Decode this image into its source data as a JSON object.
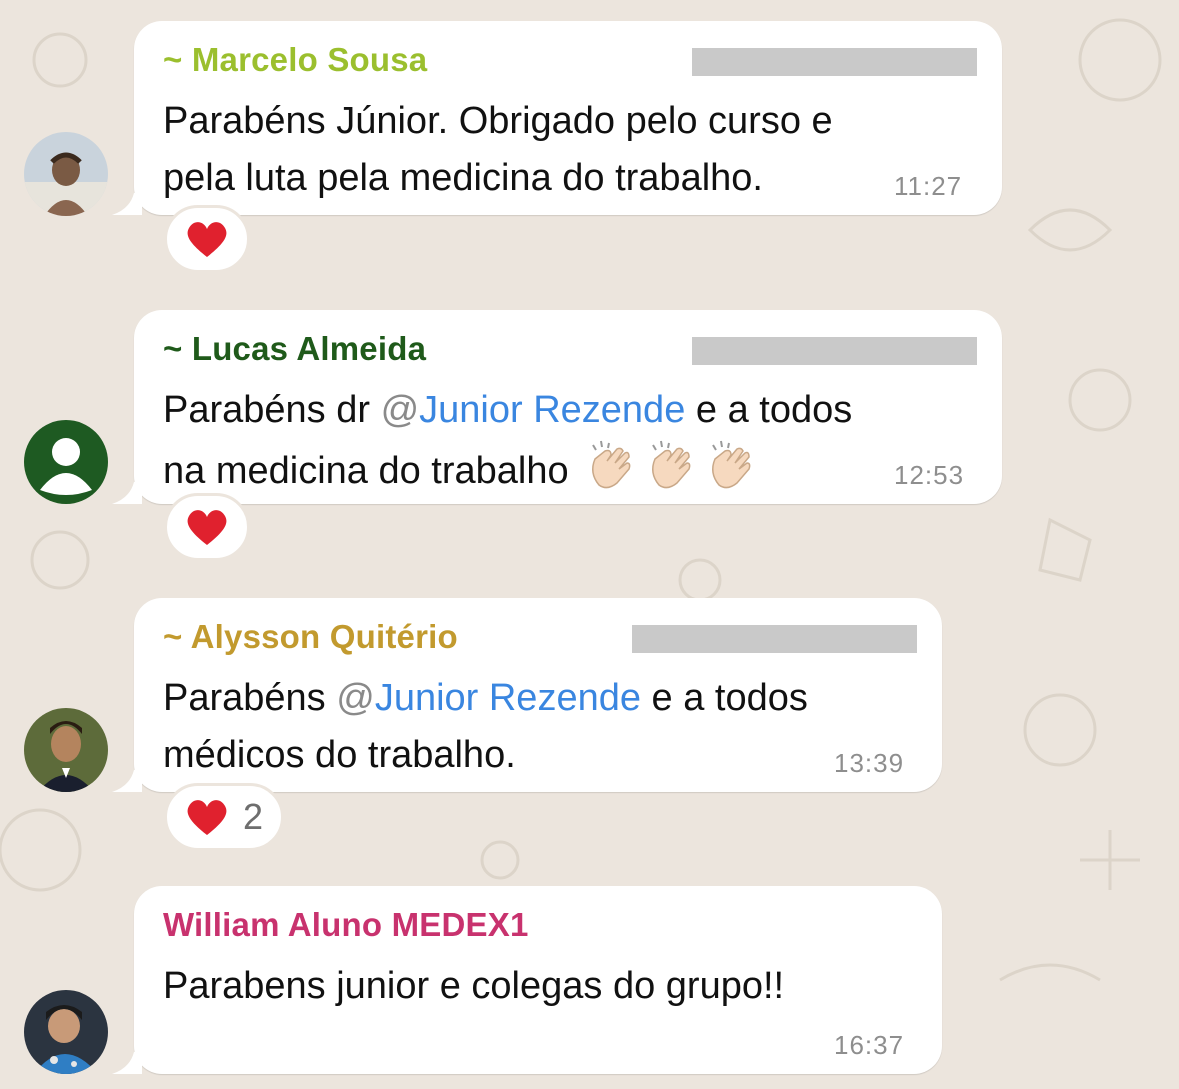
{
  "colors": {
    "background": "#ECE5DD",
    "bubble": "#FFFFFF",
    "mention": "#3A86E0",
    "timestamp": "#8E8E8E"
  },
  "messages": [
    {
      "sender": "~ Marcelo Sousa",
      "sender_color": "#9BBF2E",
      "text_lines": [
        "Parabéns Júnior. Obrigado pelo curso e",
        "pela luta pela medicina do trabalho."
      ],
      "time": "11:27",
      "reaction": {
        "emoji": "heart-icon",
        "count": ""
      }
    },
    {
      "sender": "~ Lucas Almeida",
      "sender_color": "#1F5A1A",
      "text_line1_prefix": "Parabéns dr ",
      "text_line1_at": "@",
      "text_line1_mention": "Junior Rezende",
      "text_line1_suffix": " e a todos",
      "text_line2": "na medicina do trabalho",
      "emojis": [
        "clapping-hands-icon",
        "clapping-hands-icon",
        "clapping-hands-icon"
      ],
      "time": "12:53",
      "reaction": {
        "emoji": "heart-icon",
        "count": ""
      }
    },
    {
      "sender": "~ Alysson Quitério",
      "sender_color": "#C29A2E",
      "text_line1_prefix": "Parabéns ",
      "text_line1_at": "@",
      "text_line1_mention": "Junior Rezende",
      "text_line1_suffix": " e a todos",
      "text_line2": "médicos do trabalho.",
      "time": "13:39",
      "reaction": {
        "emoji": "heart-icon",
        "count": "2"
      }
    },
    {
      "sender": "William Aluno MEDEX1",
      "sender_color": "#C8326E",
      "text": "Parabens junior e colegas do grupo!!",
      "time": "16:37"
    }
  ]
}
